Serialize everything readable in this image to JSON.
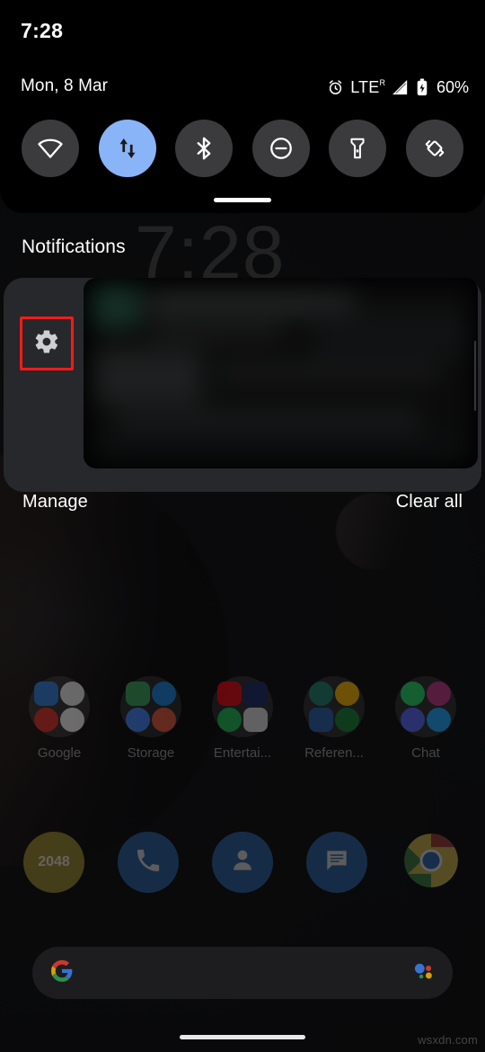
{
  "device": {
    "status_bar": {
      "time": "7:28"
    },
    "home_gesture_bar": "home-indicator"
  },
  "quick_settings": {
    "date": "Mon, 8 Mar",
    "status_icons": {
      "alarm": "alarm-icon",
      "network_type": "LTE",
      "roaming_indicator": "R",
      "signal": "signal-bars-icon",
      "battery": "battery-charging-icon",
      "battery_percent": "60%"
    },
    "tiles": [
      {
        "name": "wifi",
        "icon": "wifi-icon",
        "label": "Wi-Fi",
        "active": false
      },
      {
        "name": "mobile-data",
        "icon": "mobile-data-icon",
        "label": "Mobile data",
        "active": true
      },
      {
        "name": "bluetooth",
        "icon": "bluetooth-icon",
        "label": "Bluetooth",
        "active": false
      },
      {
        "name": "do-not-disturb",
        "icon": "do-not-disturb-icon",
        "label": "Do Not Disturb",
        "active": false
      },
      {
        "name": "flashlight",
        "icon": "flashlight-icon",
        "label": "Flashlight",
        "active": false
      },
      {
        "name": "auto-rotate",
        "icon": "auto-rotate-icon",
        "label": "Auto-rotate",
        "active": false
      }
    ],
    "drag_handle": "qs-drag-handle",
    "panel_bg": "#000000",
    "active_tile_color": "#8ab4f8",
    "inactive_tile_color": "#3b3b3d"
  },
  "clock_widget": {
    "time": "7:28"
  },
  "notifications": {
    "header": "Notifications",
    "swipe_action_icon": "gear-icon",
    "highlight_color": "#f51a1a",
    "card": {
      "content": "",
      "state": "blurred"
    },
    "manage_label": "Manage",
    "clear_all_label": "Clear all"
  },
  "home_screen": {
    "folders": [
      {
        "label": "Google",
        "apps": [
          {
            "name": "play-store-icon",
            "color": "#2b7bd6"
          },
          {
            "name": "google-icon",
            "color": "#e8e8e8"
          },
          {
            "name": "gmail-icon",
            "color": "#d93025"
          },
          {
            "name": "photos-icon",
            "color": "#f0f0f0"
          }
        ]
      },
      {
        "label": "Storage",
        "apps": [
          {
            "name": "drive-icon",
            "color": "#3ca55c"
          },
          {
            "name": "onedrive-icon",
            "color": "#1a84d8"
          },
          {
            "name": "files-icon",
            "color": "#4285f4"
          },
          {
            "name": "dropbox-icon",
            "color": "#e05a3a"
          }
        ]
      },
      {
        "label": "Entertai...",
        "apps": [
          {
            "name": "netflix-icon",
            "color": "#e50914"
          },
          {
            "name": "prime-video-icon",
            "color": "#1c2b63"
          },
          {
            "name": "spotify-icon",
            "color": "#1db954"
          },
          {
            "name": "play-movies-icon",
            "color": "#dadada"
          }
        ]
      },
      {
        "label": "Referen...",
        "apps": [
          {
            "name": "classroom-icon",
            "color": "#1e7f6e"
          },
          {
            "name": "keep-icon",
            "color": "#f4b400"
          },
          {
            "name": "docs-icon",
            "color": "#2b5fa8"
          },
          {
            "name": "sheets-icon",
            "color": "#188038"
          }
        ]
      },
      {
        "label": "Chat",
        "apps": [
          {
            "name": "whatsapp-icon",
            "color": "#25d366"
          },
          {
            "name": "instagram-icon",
            "color": "#c13584"
          },
          {
            "name": "discord-icon",
            "color": "#5865f2"
          },
          {
            "name": "twitter-icon",
            "color": "#1da1f2"
          }
        ]
      }
    ],
    "dock": [
      {
        "name": "2048-icon",
        "label": "2048",
        "color": "#9a8c2e"
      },
      {
        "name": "phone-icon",
        "label": "",
        "color": "#2a5f9e"
      },
      {
        "name": "contacts-icon",
        "label": "",
        "color": "#2a5f9e"
      },
      {
        "name": "messages-icon",
        "label": "",
        "color": "#2a5f9e"
      },
      {
        "name": "chrome-icon",
        "label": "",
        "color": "#2a5f9e"
      }
    ],
    "search_bar": {
      "logo": "google-g-icon",
      "placeholder": "",
      "assistant_icon": "google-assistant-icon"
    }
  },
  "watermark": "wsxdn.com"
}
